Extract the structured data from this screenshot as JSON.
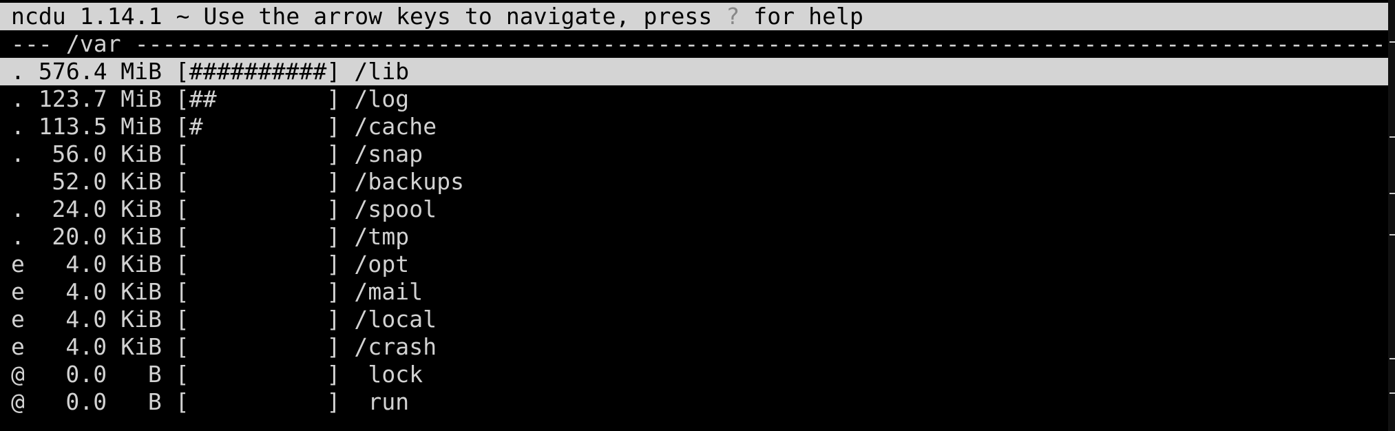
{
  "title_bar": {
    "prefix": "ncdu 1.14.1 ~ Use the arrow keys to navigate, press ",
    "help_key": "?",
    "suffix": " for help"
  },
  "path_bar": "--- /var -------------------------------------------------------------------------------------------------------------------------------------",
  "rows": [
    {
      "flag": ".",
      "size": "576.4",
      "unit": "MiB",
      "bar": "##########",
      "name": "/lib",
      "selected": true
    },
    {
      "flag": ".",
      "size": "123.7",
      "unit": "MiB",
      "bar": "##        ",
      "name": "/log",
      "selected": false
    },
    {
      "flag": ".",
      "size": "113.5",
      "unit": "MiB",
      "bar": "#         ",
      "name": "/cache",
      "selected": false
    },
    {
      "flag": ".",
      "size": "56.0",
      "unit": "KiB",
      "bar": "          ",
      "name": "/snap",
      "selected": false
    },
    {
      "flag": " ",
      "size": "52.0",
      "unit": "KiB",
      "bar": "          ",
      "name": "/backups",
      "selected": false
    },
    {
      "flag": ".",
      "size": "24.0",
      "unit": "KiB",
      "bar": "          ",
      "name": "/spool",
      "selected": false
    },
    {
      "flag": ".",
      "size": "20.0",
      "unit": "KiB",
      "bar": "          ",
      "name": "/tmp",
      "selected": false
    },
    {
      "flag": "e",
      "size": "4.0",
      "unit": "KiB",
      "bar": "          ",
      "name": "/opt",
      "selected": false
    },
    {
      "flag": "e",
      "size": "4.0",
      "unit": "KiB",
      "bar": "          ",
      "name": "/mail",
      "selected": false
    },
    {
      "flag": "e",
      "size": "4.0",
      "unit": "KiB",
      "bar": "          ",
      "name": "/local",
      "selected": false
    },
    {
      "flag": "e",
      "size": "4.0",
      "unit": "KiB",
      "bar": "          ",
      "name": "/crash",
      "selected": false
    },
    {
      "flag": "@",
      "size": "0.0",
      "unit": "B",
      "bar": "          ",
      "name": " lock",
      "selected": false
    },
    {
      "flag": "@",
      "size": "0.0",
      "unit": "B",
      "bar": "          ",
      "name": " run",
      "selected": false
    }
  ],
  "colors": {
    "background": "#000000",
    "foreground": "#d2d2d2",
    "highlight_bg": "#d4d4d4",
    "highlight_fg": "#000000"
  }
}
